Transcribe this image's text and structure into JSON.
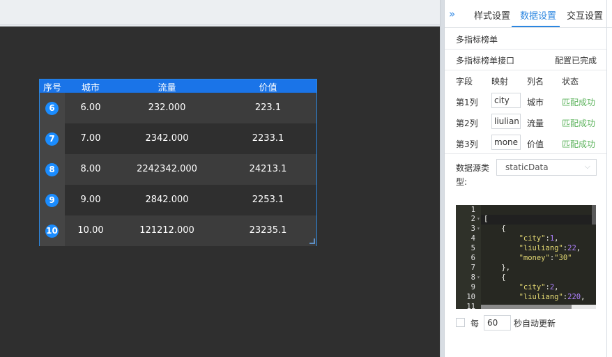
{
  "table": {
    "headers": [
      "序号",
      "城市",
      "流量",
      "价值"
    ],
    "rows": [
      {
        "rank": "6",
        "city": "6.00",
        "flow": "232.000",
        "value": "223.1"
      },
      {
        "rank": "7",
        "city": "7.00",
        "flow": "2342.000",
        "value": "2233.1"
      },
      {
        "rank": "8",
        "city": "8.00",
        "flow": "2242342.000",
        "value": "24213.1"
      },
      {
        "rank": "9",
        "city": "9.00",
        "flow": "2842.000",
        "value": "2253.1"
      },
      {
        "rank": "10",
        "city": "10.00",
        "flow": "121212.000",
        "value": "23235.1"
      }
    ]
  },
  "panel": {
    "collapse_icon": "»",
    "tabs": [
      "样式设置",
      "数据设置",
      "交互设置"
    ],
    "active_tab": "数据设置",
    "section_title": "多指标榜单",
    "api_label": "多指标榜单接口",
    "api_status": "配置已完成",
    "field_headers": [
      "字段",
      "映射",
      "列名",
      "状态"
    ],
    "fields": [
      {
        "field": "第1列",
        "mapping": "city",
        "column": "城市",
        "status": "匹配成功"
      },
      {
        "field": "第2列",
        "mapping": "liulian",
        "column": "流量",
        "status": "匹配成功"
      },
      {
        "field": "第3列",
        "mapping": "mone",
        "column": "价值",
        "status": "匹配成功"
      }
    ],
    "datasource_label": "数据源类型:",
    "datasource_value": "staticData",
    "editor": {
      "line_numbers": [
        "1",
        "2",
        "3",
        "4",
        "5",
        "6",
        "7",
        "8",
        "9",
        "10",
        "11"
      ]
    },
    "auto_update": {
      "prefix": "每",
      "seconds": "60",
      "suffix": "秒自动更新",
      "checked": false
    }
  }
}
